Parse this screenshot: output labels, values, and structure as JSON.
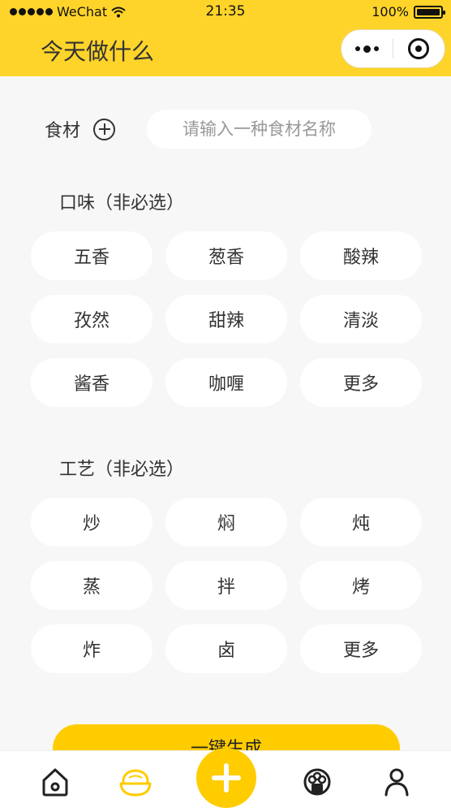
{
  "status_bar": {
    "carrier": "WeChat",
    "time": "21:35",
    "battery": "100%"
  },
  "nav": {
    "title": "今天做什么"
  },
  "ingredients": {
    "label": "食材",
    "placeholder": "请输入一种食材名称"
  },
  "flavor": {
    "title": "口味（非必选）",
    "options": [
      "五香",
      "葱香",
      "酸辣",
      "孜然",
      "甜辣",
      "清淡",
      "酱香",
      "咖喱",
      "更多"
    ]
  },
  "technique": {
    "title": "工艺（非必选）",
    "options": [
      "炒",
      "焖",
      "炖",
      "蒸",
      "拌",
      "烤",
      "炸",
      "卤",
      "更多"
    ]
  },
  "generate_button": {
    "label": "一键生成"
  },
  "tabbar": {
    "accent": "#ffcc00",
    "icons": [
      "home-icon",
      "bowl-icon",
      "plus-icon",
      "chef-hat-icon",
      "user-icon"
    ]
  }
}
